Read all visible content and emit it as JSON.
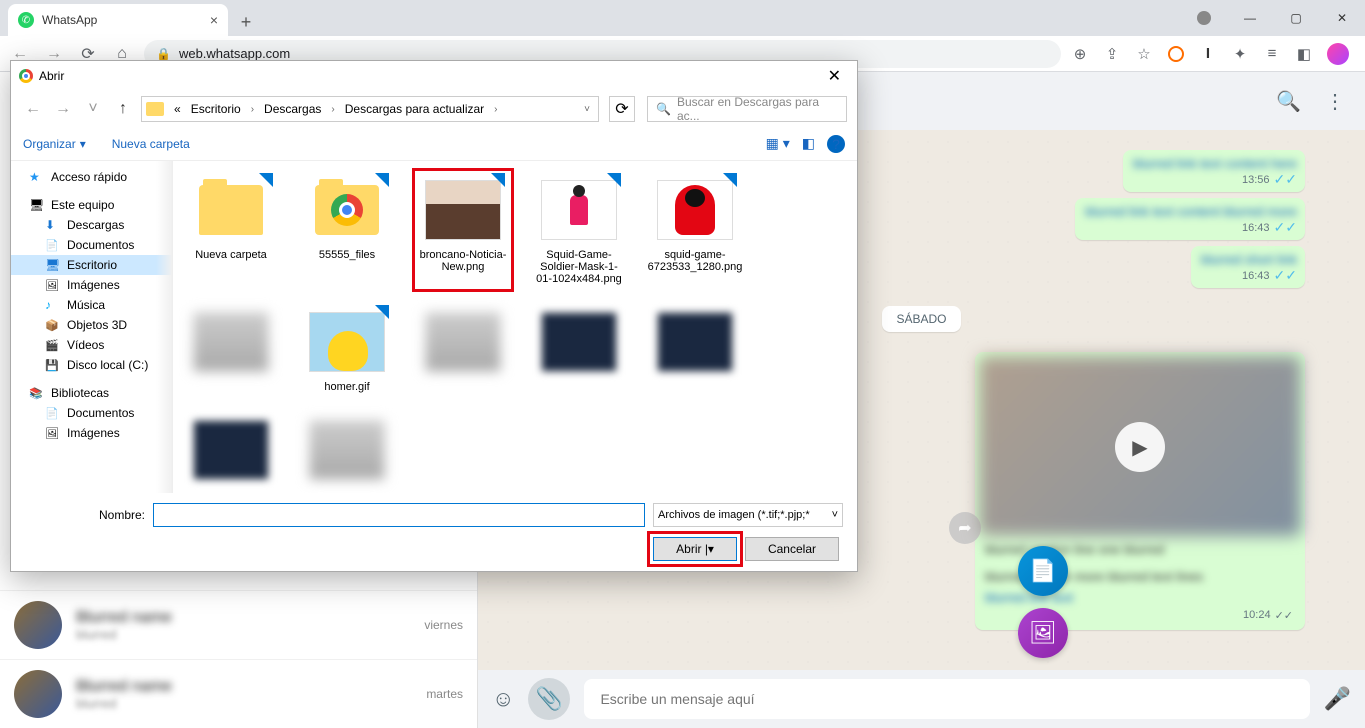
{
  "browser": {
    "tab_title": "WhatsApp",
    "url": "web.whatsapp.com"
  },
  "whatsapp": {
    "chats": [
      {
        "name": "Blurred name",
        "sub": "blurred",
        "time": "viernes"
      },
      {
        "name": "Blurred name",
        "sub": "blurred",
        "time": "martes"
      }
    ],
    "messages": [
      {
        "text": "blurred link text content here",
        "time": "13:56"
      },
      {
        "text": "blurred link text content blurred more",
        "time": "16:43"
      },
      {
        "text": "blurred short link",
        "time": "16:43"
      }
    ],
    "date_separator": "SÁBADO",
    "media_time": "10:24",
    "compose_placeholder": "Escribe un mensaje aquí"
  },
  "dialog": {
    "title": "Abrir",
    "breadcrumb_prefix": "«",
    "breadcrumb": [
      "Escritorio",
      "Descargas",
      "Descargas para actualizar"
    ],
    "search_placeholder": "Buscar en Descargas para ac...",
    "toolbar": {
      "organize": "Organizar",
      "new_folder": "Nueva carpeta"
    },
    "tree": {
      "quick": "Acceso rápido",
      "pc": "Este equipo",
      "downloads": "Descargas",
      "documents": "Documentos",
      "desktop": "Escritorio",
      "images": "Imágenes",
      "music": "Música",
      "objects3d": "Objetos 3D",
      "videos": "Vídeos",
      "disk": "Disco local (C:)",
      "libraries": "Bibliotecas",
      "lib_documents": "Documentos",
      "lib_images": "Imágenes"
    },
    "files": [
      {
        "name": "Nueva carpeta",
        "kind": "folder"
      },
      {
        "name": "55555_files",
        "kind": "folder-chrome"
      },
      {
        "name": "broncano-Noticia-New.png",
        "kind": "face",
        "selected": true
      },
      {
        "name": "Squid-Game-Soldier-Mask-1-01-1024x484.png",
        "kind": "squid-sol"
      },
      {
        "name": "squid-game-6723533_1280.png",
        "kind": "squid-red"
      },
      {
        "name": "",
        "kind": "blur"
      },
      {
        "name": "homer.gif",
        "kind": "homer"
      },
      {
        "name": "",
        "kind": "blur"
      },
      {
        "name": "",
        "kind": "dark"
      },
      {
        "name": "",
        "kind": "dark"
      },
      {
        "name": "",
        "kind": "dark"
      },
      {
        "name": "",
        "kind": "blur"
      }
    ],
    "footer": {
      "name_label": "Nombre:",
      "filetype": "Archivos de imagen (*.tif;*.pjp;*",
      "open": "Abrir",
      "cancel": "Cancelar"
    }
  }
}
